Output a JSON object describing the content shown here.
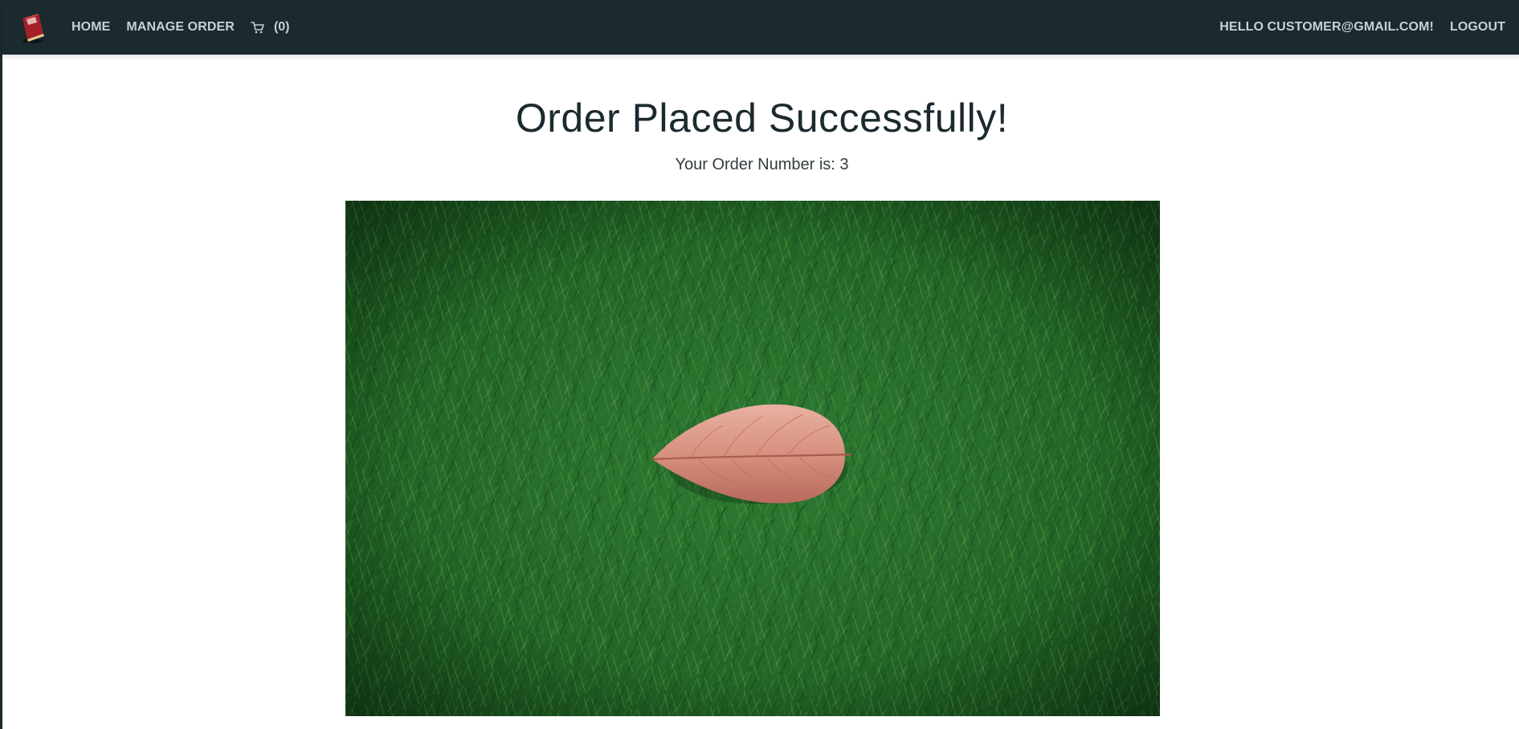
{
  "navbar": {
    "logo_icon": "book-logo-icon",
    "links": [
      {
        "label": "HOME"
      },
      {
        "label": "MANAGE ORDER"
      }
    ],
    "cart": {
      "icon": "cart-icon",
      "count_text": "(0)"
    },
    "greeting": "HELLO CUSTOMER@GMAIL.COM!",
    "logout_label": "LOGOUT"
  },
  "main": {
    "title": "Order Placed Successfully!",
    "order_text": "Your Order Number is: 3"
  },
  "hero_image": {
    "subject": "leaf-on-grass-image"
  },
  "colors": {
    "navbar_bg": "#1b2a2e",
    "nav_text": "#c9d0d2",
    "title_text": "#1b2a2e"
  }
}
